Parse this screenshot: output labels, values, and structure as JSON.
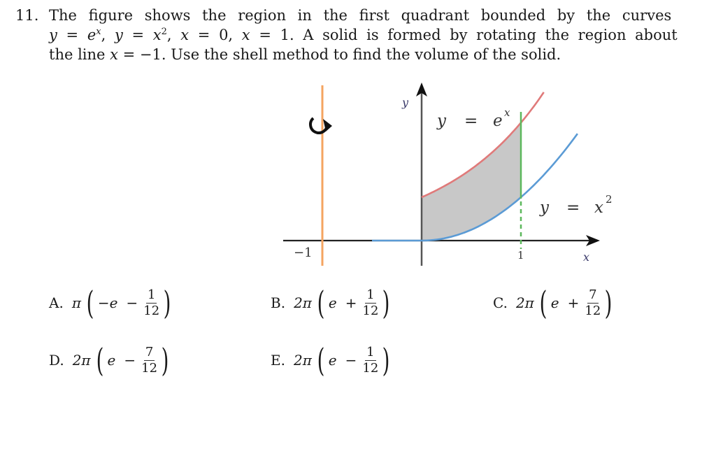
{
  "question": {
    "number": "11.",
    "line1": "The figure shows the region in the first quadrant bounded by the curves",
    "line2": {
      "parts": [
        "y",
        " = ",
        "e",
        "x",
        ", ",
        "y",
        " = ",
        "x",
        "2",
        ", ",
        "x",
        " = 0, ",
        "x",
        " = 1. A solid is formed by rotating the region about"
      ]
    },
    "line3": {
      "pre": "the line ",
      "var": "x",
      "post": " = −1. Use the shell method to find the volume of the solid."
    }
  },
  "figure": {
    "labels": {
      "y_axis": "y",
      "x_axis": "x",
      "tick_x1": "1",
      "tick_xneg1": "−1",
      "curve_exp_lhs": "y",
      "curve_exp_eq": "=",
      "curve_exp_base": "e",
      "curve_exp_pow": "x",
      "curve_sq_lhs": "y",
      "curve_sq_eq": "=",
      "curve_sq_base": "x",
      "curve_sq_pow": "2"
    },
    "icons": {
      "rotation": "rotation-arrow-icon"
    },
    "colors": {
      "exp_curve": "#e07a7a",
      "sq_curve": "#5b9bd5",
      "axis_of_rotation": "#f4a460",
      "boundary_x1": "#5cb85c",
      "region_fill": "#c8c8c8",
      "axes": "#333333"
    },
    "region": {
      "x_from": 0,
      "x_to": 1,
      "upper": "e^x",
      "lower": "x^2"
    },
    "axis_of_rotation_x": -1
  },
  "choices": [
    {
      "letter": "A.",
      "coef": "π",
      "first": "−e",
      "op": "−",
      "num": "1",
      "den": "12"
    },
    {
      "letter": "B.",
      "coef": "2π",
      "first": "e",
      "op": "+",
      "num": "1",
      "den": "12"
    },
    {
      "letter": "C.",
      "coef": "2π",
      "first": "e",
      "op": "+",
      "num": "7",
      "den": "12"
    },
    {
      "letter": "D.",
      "coef": "2π",
      "first": "e",
      "op": "−",
      "num": "7",
      "den": "12"
    },
    {
      "letter": "E.",
      "coef": "2π",
      "first": "e",
      "op": "−",
      "num": "1",
      "den": "12"
    }
  ]
}
